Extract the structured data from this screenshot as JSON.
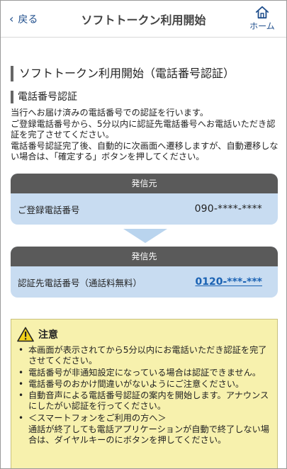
{
  "header": {
    "back_label": "戻る",
    "title": "ソフトトークン利用開始",
    "home_label": "ホーム"
  },
  "main": {
    "page_heading": "ソフトトークン利用開始（電話番号認証）",
    "section_heading": "電話番号認証",
    "description": [
      "当行へお届け済みの電話番号での認証を行います。",
      "ご登録電話番号から、5分以内に認証先電話番号へお電話いただき認証を完了させてください。",
      "電話番号認証完了後、自動的に次画面へ遷移しますが、自動遷移しない場合は、「確定する」ボタンを押してください。"
    ],
    "from_card": {
      "header": "発信元",
      "label": "ご登録電話番号",
      "value": "090-****-****"
    },
    "to_card": {
      "header": "発信先",
      "label": "認証先電話番号（通話料無料）",
      "value": "0120-***-***"
    },
    "notice": {
      "title": "注意",
      "items": [
        "本画面が表示されてから5分以内にお電話いただき認証を完了させてください。",
        "電話番号が非通知設定になっている場合は認証できません。",
        "電話番号のおかけ間違いがないようにご注意ください。",
        "自動音声による電話番号認証の案内を開始します。アナウンスにしたがい認証を行ってください。",
        "＜スマートフォンをご利用の方へ＞"
      ],
      "tail": "通話が終了しても電話アプリケーションが自動で終了しない場合は、ダイヤルキーのにボタンを押してください。"
    }
  },
  "colors": {
    "accent": "#1f4e8c",
    "card_header": "#5a5a5a",
    "card_body": "#c8dcf1",
    "notice_bg": "#f7f1ad",
    "link": "#1a62b3"
  },
  "icons": {
    "back": "chevron-left-icon",
    "home": "home-icon",
    "warning": "warning-icon"
  }
}
